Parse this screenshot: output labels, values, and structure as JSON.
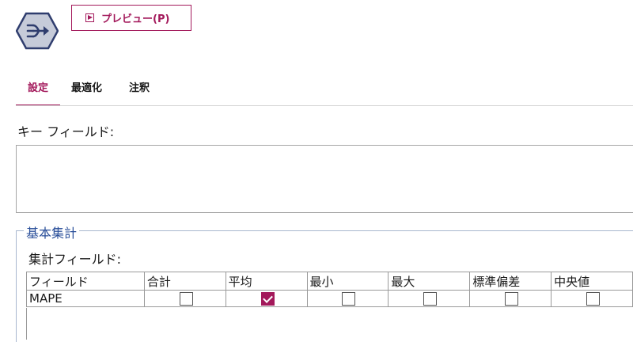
{
  "preview_button": {
    "label": "プレビュー(P)"
  },
  "tabs": [
    {
      "label": "設定",
      "active": true
    },
    {
      "label": "最適化",
      "active": false
    },
    {
      "label": "注釈",
      "active": false
    }
  ],
  "key_fields": {
    "label": "キー フィールド:",
    "items": []
  },
  "basic_aggregates": {
    "title": "基本集計",
    "fields_label": "集計フィールド:",
    "columns": [
      "フィールド",
      "合計",
      "平均",
      "最小",
      "最大",
      "標準偏差",
      "中央値"
    ],
    "rows": [
      {
        "field": "MAPE",
        "checks": [
          false,
          true,
          false,
          false,
          false,
          false
        ]
      }
    ]
  },
  "colors": {
    "accent": "#a3195b",
    "group_title": "#2a4f9a",
    "icon": "#2f3d6e"
  },
  "icons": {
    "node": "merge-arrows-hexagon-icon",
    "preview": "play-icon"
  }
}
